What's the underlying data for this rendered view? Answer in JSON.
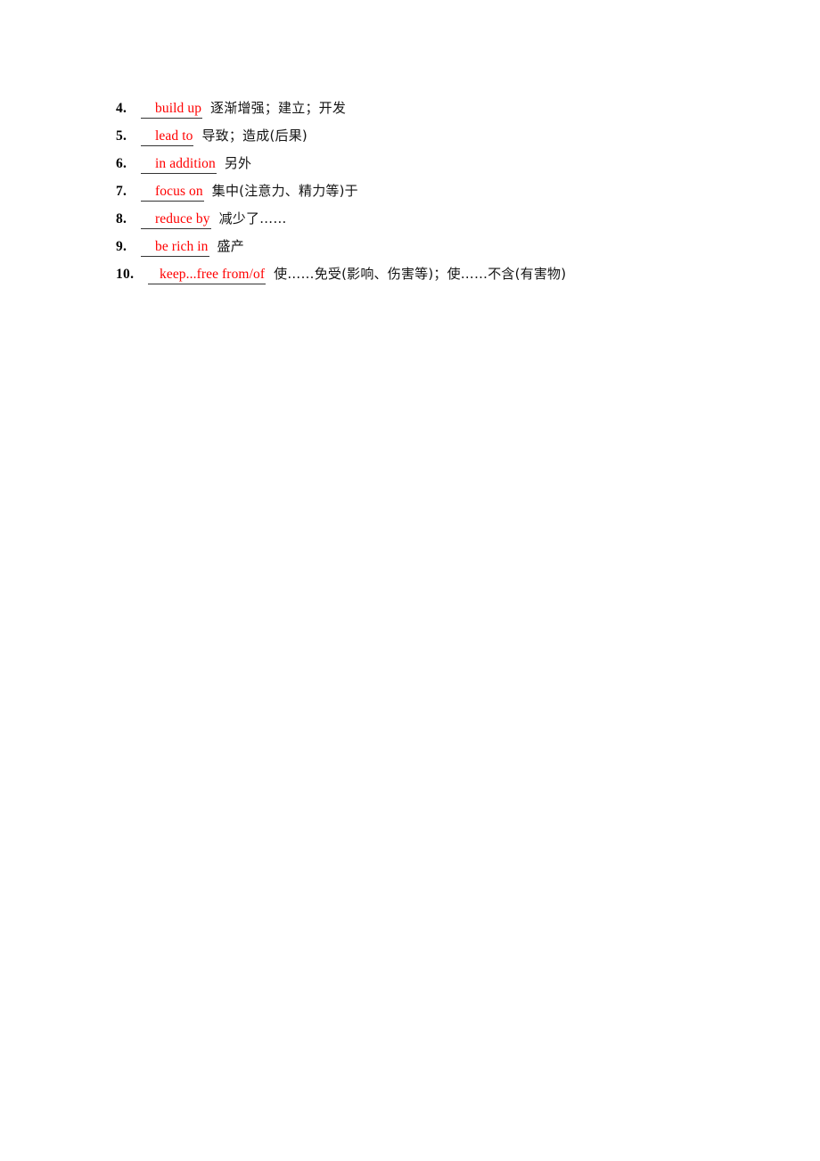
{
  "document": {
    "kind": "worksheet-answer-key",
    "accent_color": "#FF0000",
    "text_color": "#141414",
    "blank_rule_color": "#333333"
  },
  "items": [
    {
      "number": "4.",
      "answer": "build up",
      "gloss": "逐渐增强；建立；开发"
    },
    {
      "number": "5.",
      "answer": "lead to",
      "gloss": "导致；造成(后果)"
    },
    {
      "number": "6.",
      "answer": "in addition",
      "gloss": "另外"
    },
    {
      "number": "7.",
      "answer": "focus on",
      "gloss": "集中(注意力、精力等)于"
    },
    {
      "number": "8.",
      "answer": "reduce by",
      "gloss": "减少了……"
    },
    {
      "number": "9.",
      "answer": "be rich in",
      "gloss": "盛产"
    },
    {
      "number": "10.",
      "answer": "keep...free from/of",
      "gloss": "使……免受(影响、伤害等)；使……不含(有害物)"
    }
  ]
}
